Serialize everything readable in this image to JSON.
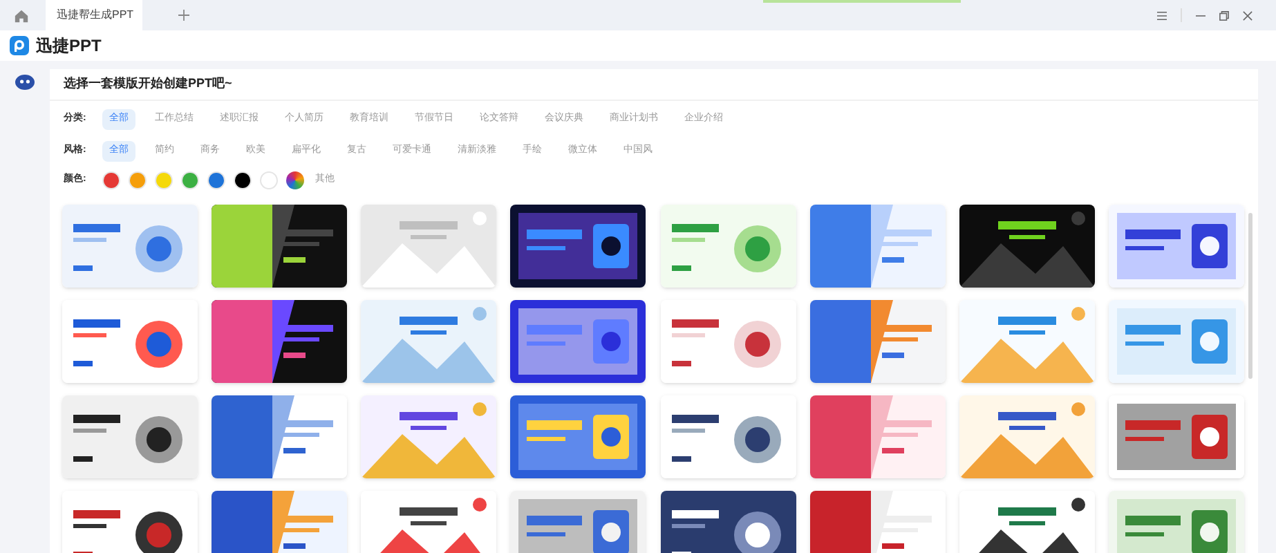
{
  "window": {
    "tab_title": "迅捷帮生成PPT"
  },
  "app": {
    "logo_text": "迅捷PPT"
  },
  "panel": {
    "title": "选择一套模版开始创建PPT吧~",
    "filters": [
      {
        "label": "分类:",
        "options": [
          {
            "text": "全部",
            "selected": true
          },
          {
            "text": "工作总结",
            "selected": false
          },
          {
            "text": "述职汇报",
            "selected": false
          },
          {
            "text": "个人简历",
            "selected": false
          },
          {
            "text": "教育培训",
            "selected": false
          },
          {
            "text": "节假节日",
            "selected": false
          },
          {
            "text": "论文答辩",
            "selected": false
          },
          {
            "text": "会议庆典",
            "selected": false
          },
          {
            "text": "商业计划书",
            "selected": false
          },
          {
            "text": "企业介绍",
            "selected": false
          }
        ]
      },
      {
        "label": "风格:",
        "options": [
          {
            "text": "全部",
            "selected": true
          },
          {
            "text": "简约",
            "selected": false
          },
          {
            "text": "商务",
            "selected": false
          },
          {
            "text": "欧美",
            "selected": false
          },
          {
            "text": "扁平化",
            "selected": false
          },
          {
            "text": "复古",
            "selected": false
          },
          {
            "text": "可爱卡通",
            "selected": false
          },
          {
            "text": "清新淡雅",
            "selected": false
          },
          {
            "text": "手绘",
            "selected": false
          },
          {
            "text": "微立体",
            "selected": false
          },
          {
            "text": "中国风",
            "selected": false
          }
        ]
      }
    ],
    "colors": {
      "label": "颜色:",
      "swatches": [
        {
          "color": "#e53935"
        },
        {
          "color": "#f59e0b"
        },
        {
          "color": "#f5d90a"
        },
        {
          "color": "#3cb043"
        },
        {
          "color": "#1e73d8"
        },
        {
          "color": "#000000"
        },
        {
          "color": "#ffffff"
        }
      ],
      "other_label": "其他"
    }
  }
}
